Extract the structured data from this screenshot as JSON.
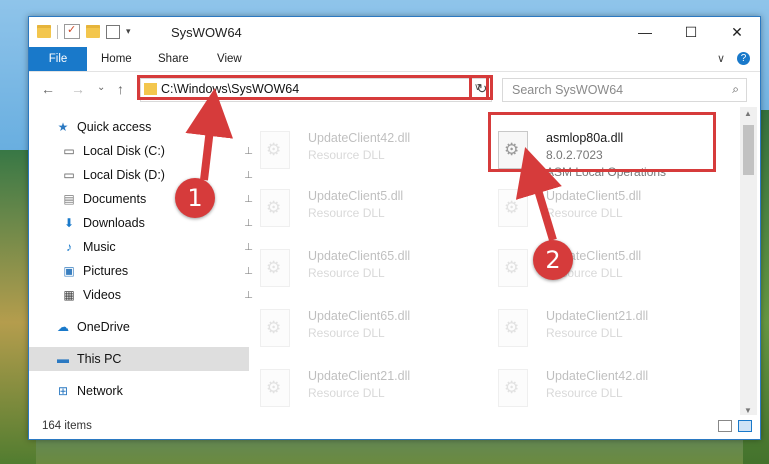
{
  "window": {
    "title": "SysWOW64",
    "minimize": "—",
    "maximize": "☐",
    "close": "✕"
  },
  "ribbon": {
    "tabs": [
      "File",
      "Home",
      "Share",
      "View"
    ],
    "expand": "∨",
    "help": "?"
  },
  "toolbar": {
    "back": "←",
    "forward": "→",
    "recent": "⌄",
    "up": "↑",
    "refresh": "↻"
  },
  "address": {
    "path": "C:\\Windows\\SysWOW64",
    "dropdown": "∨"
  },
  "search": {
    "placeholder": "Search SysWOW64",
    "icon": "⌕"
  },
  "sidebar": [
    {
      "label": "Quick access",
      "icon": "star-icon",
      "glyph": "★",
      "color": "#2b79c2",
      "pinned": false
    },
    {
      "label": "Local Disk (C:)",
      "icon": "drive-icon",
      "glyph": "▭",
      "color": "#555",
      "pinned": true
    },
    {
      "label": "Local Disk (D:)",
      "icon": "drive-icon",
      "glyph": "▭",
      "color": "#555",
      "pinned": true
    },
    {
      "label": "Documents",
      "icon": "documents-icon",
      "glyph": "▤",
      "color": "#777",
      "pinned": true
    },
    {
      "label": "Downloads",
      "icon": "downloads-icon",
      "glyph": "⬇",
      "color": "#1979ca",
      "pinned": true
    },
    {
      "label": "Music",
      "icon": "music-icon",
      "glyph": "♪",
      "color": "#1979ca",
      "pinned": true
    },
    {
      "label": "Pictures",
      "icon": "pictures-icon",
      "glyph": "▣",
      "color": "#3a7fc0",
      "pinned": true
    },
    {
      "label": "Videos",
      "icon": "videos-icon",
      "glyph": "▦",
      "color": "#444",
      "pinned": true
    },
    {
      "label": "OneDrive",
      "icon": "onedrive-icon",
      "glyph": "☁",
      "color": "#1979ca",
      "pinned": false
    },
    {
      "label": "This PC",
      "icon": "computer-icon",
      "glyph": "▬",
      "color": "#2b79c2",
      "pinned": false
    },
    {
      "label": "Network",
      "icon": "network-icon",
      "glyph": "⊞",
      "color": "#2b79c2",
      "pinned": false
    }
  ],
  "pin_glyph": "📌",
  "files_left": [
    {
      "name": "UpdateClient42.dll",
      "desc": "Resource DLL"
    },
    {
      "name": "UpdateClient5.dll",
      "desc": "Resource DLL"
    },
    {
      "name": "UpdateClient65.dll",
      "desc": "Resource DLL"
    },
    {
      "name": "UpdateClient65.dll",
      "desc": "Resource DLL"
    },
    {
      "name": "UpdateClient21.dll",
      "desc": "Resource DLL"
    }
  ],
  "files_right": [
    {
      "name": "asmlop80a.dll",
      "version": "8.0.2.7023",
      "desc": "ASM Local Operations"
    },
    {
      "name": "UpdateClient5.dll",
      "desc": "Resource DLL"
    },
    {
      "name": "UpdateClient5.dll",
      "desc": "Resource DLL"
    },
    {
      "name": "UpdateClient21.dll",
      "desc": "Resource DLL"
    },
    {
      "name": "UpdateClient42.dll",
      "desc": "Resource DLL"
    }
  ],
  "status": {
    "items": "164 items"
  },
  "annotations": {
    "step1": "1",
    "step2": "2",
    "color": "#d63b3b"
  }
}
